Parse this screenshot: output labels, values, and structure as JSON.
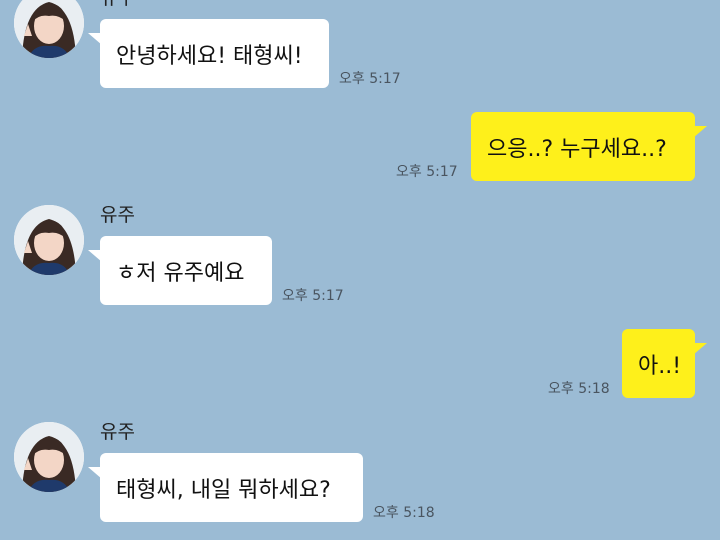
{
  "chat": {
    "background_color": "#9bbbd4",
    "incoming_bubble_color": "#ffffff",
    "outgoing_bubble_color": "#fef01b",
    "messages": [
      {
        "direction": "incoming",
        "sender": "유주",
        "text": "안녕하세요! 태형씨!",
        "time": "오후 5:17"
      },
      {
        "direction": "outgoing",
        "text": "으응..? 누구세요..?",
        "time": "오후 5:17"
      },
      {
        "direction": "incoming",
        "sender": "유주",
        "text": "ㅎ저 유주예요",
        "time": "오후 5:17"
      },
      {
        "direction": "outgoing",
        "text": "아..!",
        "time": "오후 5:18"
      },
      {
        "direction": "incoming",
        "sender": "유주",
        "text": "태형씨, 내일 뭐하세요?",
        "time": "오후 5:18"
      }
    ]
  }
}
